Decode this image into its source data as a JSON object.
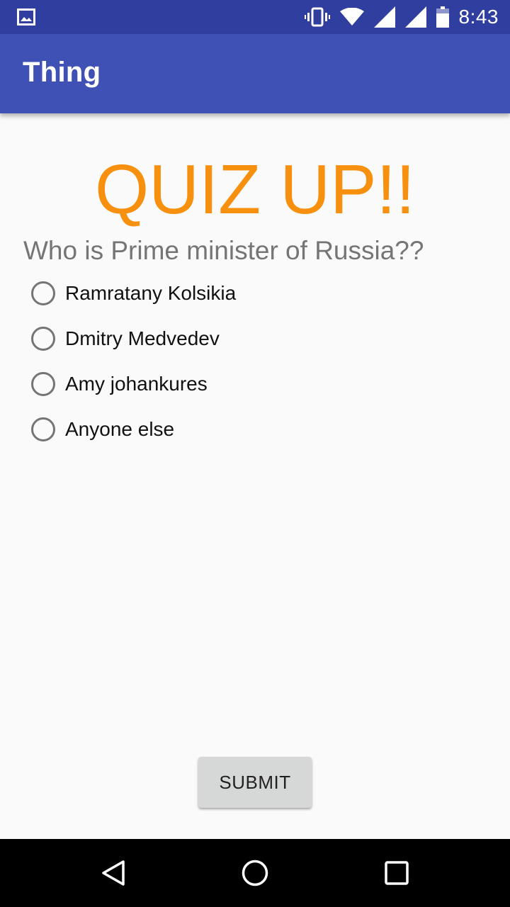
{
  "status_bar": {
    "time": "8:43",
    "icons": [
      "gallery-icon",
      "vibrate-icon",
      "wifi-icon",
      "signal-icon",
      "signal-icon",
      "battery-icon"
    ]
  },
  "app_bar": {
    "title": "Thing"
  },
  "quiz": {
    "title": "QUIZ UP!!",
    "question": "Who is Prime minister of Russia??",
    "options": [
      {
        "label": "Ramratany Kolsikia",
        "selected": false
      },
      {
        "label": "Dmitry Medvedev",
        "selected": false
      },
      {
        "label": "Amy johankures",
        "selected": false
      },
      {
        "label": "Anyone else",
        "selected": false
      }
    ],
    "submit_label": "SUBMIT"
  },
  "nav_bar": {
    "buttons": [
      "back-icon",
      "home-icon",
      "recents-icon"
    ]
  },
  "colors": {
    "status_bar": "#303f9f",
    "app_bar": "#3f51b5",
    "quiz_title": "#f7900e",
    "background": "#fafafa"
  }
}
